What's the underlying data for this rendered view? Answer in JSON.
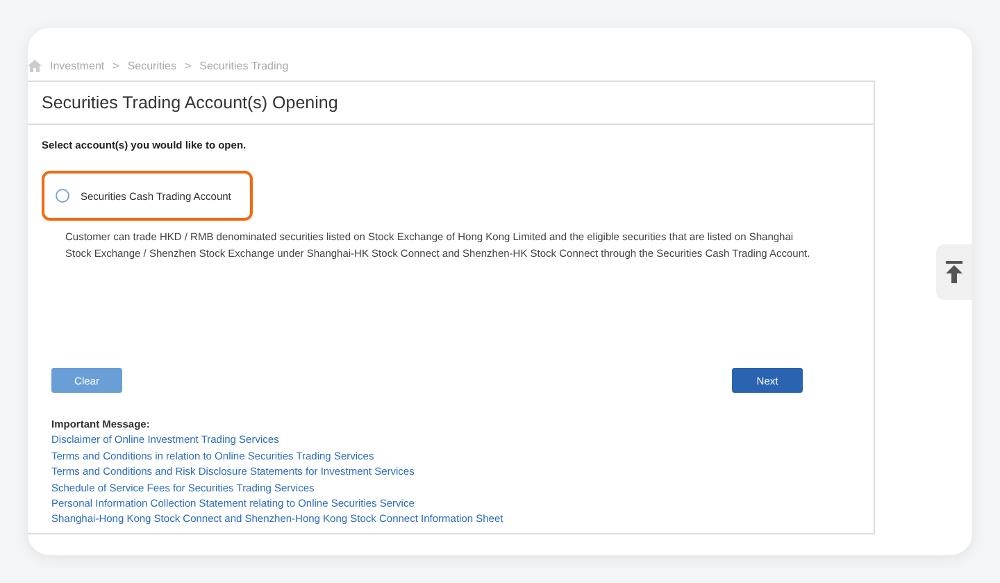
{
  "breadcrumb": [
    "Investment",
    "Securities",
    "Securities Trading"
  ],
  "breadcrumb_separator": ">",
  "panel": {
    "title": "Securities Trading Account(s) Opening",
    "instruction": "Select account(s) you would like to open.",
    "options": [
      {
        "label": "Securities Cash Trading Account",
        "selected": false,
        "highlighted": true,
        "description": "Customer can trade HKD / RMB denominated securities listed on Stock Exchange of Hong Kong Limited and the eligible securities that are listed on Shanghai Stock Exchange / Shenzhen Stock Exchange under Shanghai-HK Stock Connect and Shenzhen-HK Stock Connect through the Securities Cash Trading Account."
      }
    ],
    "buttons": [
      {
        "label": "Clear",
        "kind": "secondary",
        "disabled": true
      },
      {
        "label": "Next",
        "kind": "primary",
        "disabled": false
      }
    ],
    "important_message": {
      "heading": "Important Message:",
      "links": [
        "Disclaimer of Online Investment Trading Services",
        "Terms and Conditions in relation to Online Securities Trading Services",
        "Terms and Conditions and Risk Disclosure Statements for Investment Services",
        "Schedule of Service Fees for Securities Trading Services",
        "Personal Information Collection Statement relating to Online Securities Service",
        "Shanghai-Hong Kong Stock Connect and Shenzhen-Hong Kong Stock Connect Information Sheet"
      ]
    }
  }
}
